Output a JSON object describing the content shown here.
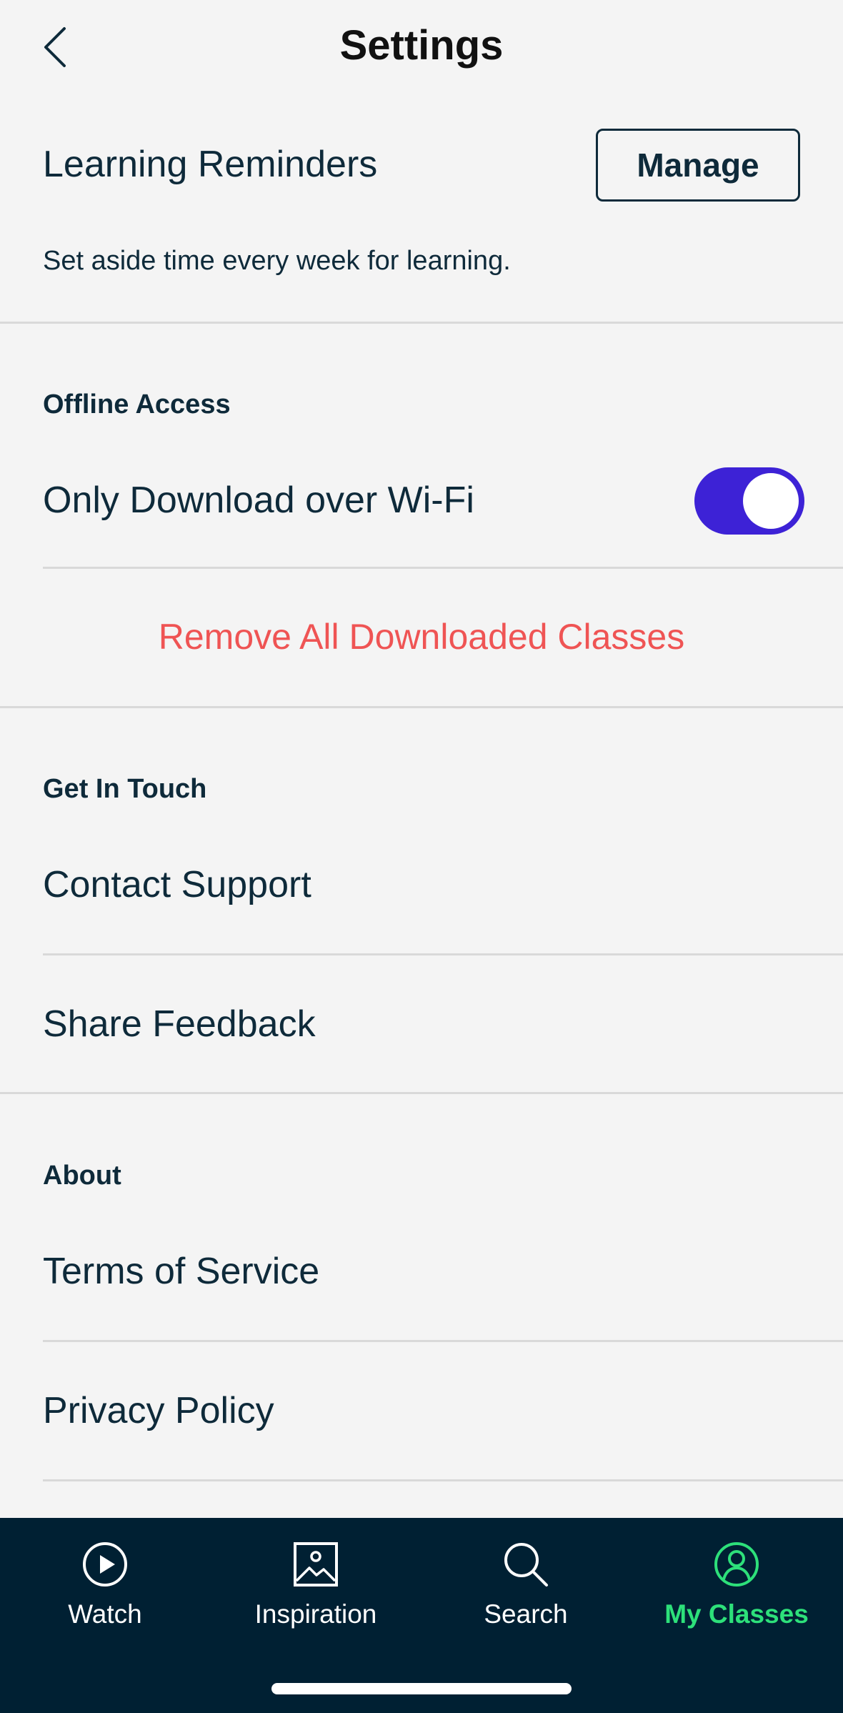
{
  "header": {
    "title": "Settings",
    "back_icon": "chevron-left-icon"
  },
  "reminders": {
    "label": "Learning Reminders",
    "manage_label": "Manage",
    "subtitle": "Set aside time every week for learning."
  },
  "offline": {
    "heading": "Offline Access",
    "wifi_label": "Only Download over Wi-Fi",
    "wifi_enabled": true,
    "remove_label": "Remove All Downloaded Classes"
  },
  "contact": {
    "heading": "Get In Touch",
    "support_label": "Contact Support",
    "feedback_label": "Share Feedback"
  },
  "about": {
    "heading": "About",
    "terms_label": "Terms of Service",
    "privacy_label": "Privacy Policy"
  },
  "nav": {
    "items": [
      {
        "label": "Watch",
        "icon": "play-circle-icon",
        "active": false
      },
      {
        "label": "Inspiration",
        "icon": "image-icon",
        "active": false
      },
      {
        "label": "Search",
        "icon": "search-icon",
        "active": false
      },
      {
        "label": "My Classes",
        "icon": "user-circle-icon",
        "active": true
      }
    ]
  },
  "colors": {
    "background": "#f4f4f4",
    "text": "#0e2a3a",
    "toggle_on": "#3d22d6",
    "destructive": "#ef5454",
    "nav_bg": "#002033",
    "nav_active": "#2de07a"
  }
}
